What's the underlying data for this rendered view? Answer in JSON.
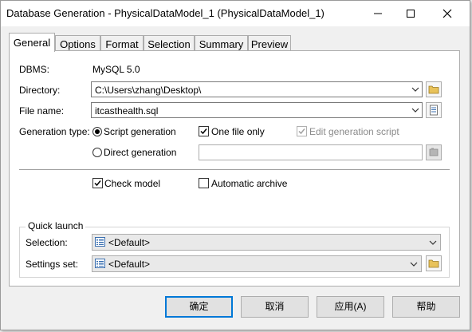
{
  "window": {
    "title": "Database Generation - PhysicalDataModel_1 (PhysicalDataModel_1)"
  },
  "tabs": [
    {
      "label": "General"
    },
    {
      "label": "Options"
    },
    {
      "label": "Format"
    },
    {
      "label": "Selection"
    },
    {
      "label": "Summary"
    },
    {
      "label": "Preview"
    }
  ],
  "general": {
    "dbms_label": "DBMS:",
    "dbms_value": "MySQL 5.0",
    "directory_label": "Directory:",
    "directory_value": "C:\\Users\\zhang\\Desktop\\",
    "filename_label": "File name:",
    "filename_value": "itcasthealth.sql",
    "gentype_label": "Generation type:",
    "script_generation": "Script generation",
    "direct_generation": "Direct generation",
    "one_file_only": "One file only",
    "edit_generation_script": "Edit generation script",
    "check_model": "Check model",
    "automatic_archive": "Automatic archive"
  },
  "quick_launch": {
    "title": "Quick launch",
    "selection_label": "Selection:",
    "selection_value": "<Default>",
    "settings_label": "Settings set:",
    "settings_value": "<Default>"
  },
  "buttons": {
    "ok": "确定",
    "cancel": "取消",
    "apply": "应用(A)",
    "help": "帮助"
  }
}
